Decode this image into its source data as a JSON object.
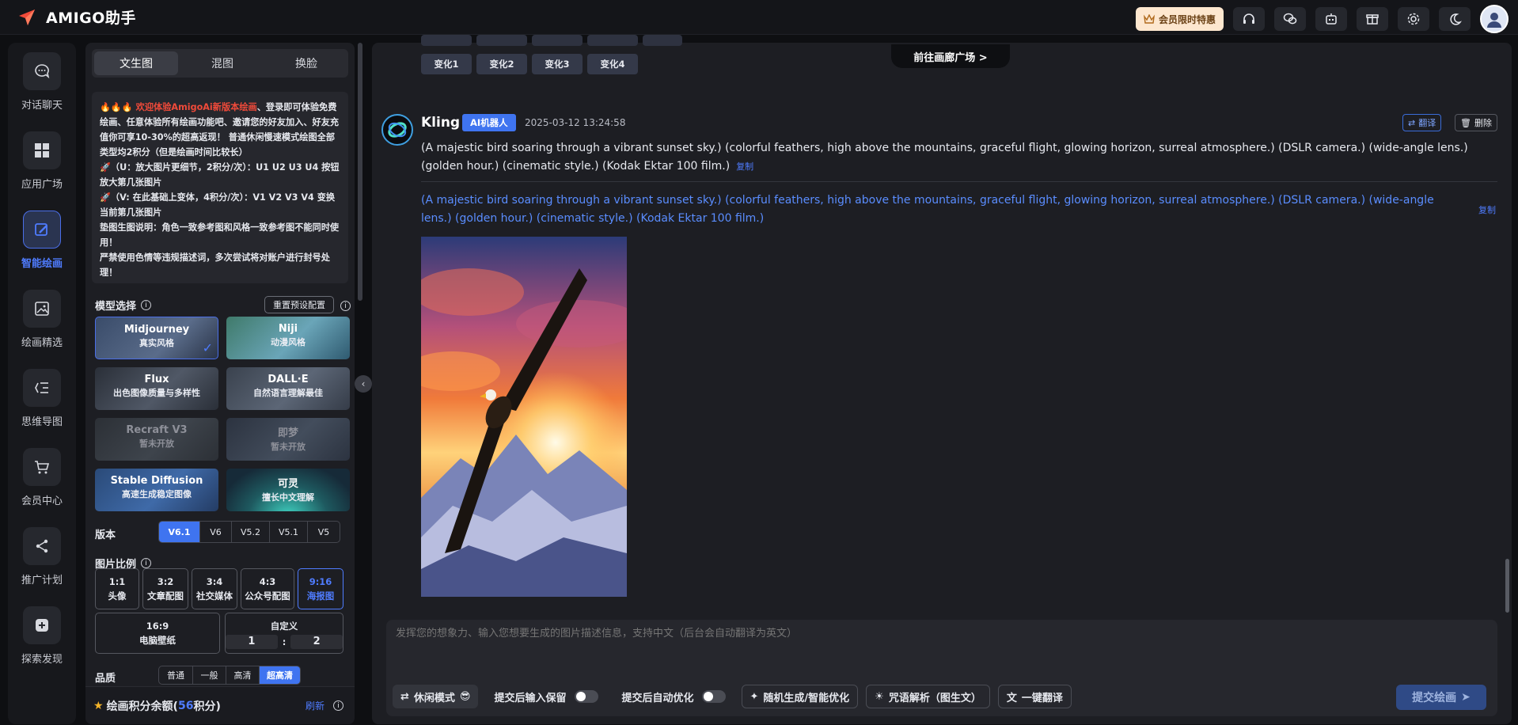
{
  "app": {
    "title": "AMIGO助手"
  },
  "header": {
    "vip_label": "会员限时特惠"
  },
  "nav": [
    {
      "id": "chat",
      "label": "对话聊天",
      "icon": "chat-icon"
    },
    {
      "id": "apps",
      "label": "应用广场",
      "icon": "grid-icon"
    },
    {
      "id": "draw",
      "label": "智能绘画",
      "icon": "brush-icon",
      "active": true
    },
    {
      "id": "gallery",
      "label": "绘画精选",
      "icon": "image-icon"
    },
    {
      "id": "mindmap",
      "label": "思维导图",
      "icon": "mindmap-icon"
    },
    {
      "id": "member",
      "label": "会员中心",
      "icon": "cart-icon"
    },
    {
      "id": "promote",
      "label": "推广计划",
      "icon": "share-icon"
    },
    {
      "id": "explore",
      "label": "探索发现",
      "icon": "explore-icon"
    }
  ],
  "panel": {
    "tabs": [
      {
        "label": "文生图",
        "active": true
      },
      {
        "label": "混图"
      },
      {
        "label": "换脸"
      }
    ],
    "notice": {
      "highlight": "🔥🔥🔥 欢迎体验AmigoAi新版本绘画",
      "body": "、登录即可体验免费绘画、任意体验所有绘画功能吧、邀请您的好友加入、好友充值你可享10-30%的超高返现！ 普通休闲慢速模式绘图全部类型均2积分（但是绘画时间比较长）",
      "line_u": "🚀（U：放大图片更细节，2积分/次）：U1 U2 U3 U4 按钮放大第几张图片",
      "line_v": "🚀（V: 在此基础上变体，4积分/次）：V1 V2 V3 V4 变换当前第几张图片",
      "line_ref": "垫图生图说明：角色一致参考图和风格一致参考图不能同时使用！",
      "line_warn": "严禁使用色情等违规描述词，多次尝试将对账户进行封号处理！"
    },
    "model_label": "模型选择",
    "reset_label": "重置预设配置",
    "models": [
      {
        "name": "Midjourney",
        "sub": "真实风格",
        "selected": true
      },
      {
        "name": "Niji",
        "sub": "动漫风格"
      },
      {
        "name": "Flux",
        "sub": "出色图像质量与多样性"
      },
      {
        "name": "DALL·E",
        "sub": "自然语言理解最佳"
      },
      {
        "name": "Recraft V3",
        "sub": "暂未开放",
        "disabled": true
      },
      {
        "name": "即梦",
        "sub": "暂未开放",
        "disabled": true
      },
      {
        "name": "Stable Diffusion",
        "sub": "高速生成稳定图像"
      },
      {
        "name": "可灵",
        "sub": "擅长中文理解"
      }
    ],
    "version_label": "版本",
    "versions": [
      "V6.1",
      "V6",
      "V5.2",
      "V5.1",
      "V5"
    ],
    "ratio_label": "图片比例",
    "ratios": [
      {
        "value": "1:1",
        "desc": "头像"
      },
      {
        "value": "3:2",
        "desc": "文章配图"
      },
      {
        "value": "3:4",
        "desc": "社交媒体"
      },
      {
        "value": "4:3",
        "desc": "公众号配图"
      },
      {
        "value": "9:16",
        "desc": "海报图",
        "active": true
      }
    ],
    "ratio_wide": {
      "value": "16:9",
      "desc": "电脑壁纸"
    },
    "custom": {
      "label": "自定义",
      "w": "1",
      "sep": ":",
      "h": "2"
    },
    "quality_label": "品质",
    "qualities": [
      "普通",
      "一般",
      "高清",
      "超高清"
    ],
    "points": {
      "prefix": "绘画积分余额(",
      "value": "56",
      "suffix": "积分)",
      "refresh": "刷新"
    }
  },
  "main": {
    "gallery_link": "前往画廊广场 >",
    "variations": [
      "变化1",
      "变化2",
      "变化3",
      "变化4"
    ],
    "message": {
      "name": "Kling",
      "badge": "AI机器人",
      "time": "2025-03-12 13:24:58",
      "translate": "翻译",
      "delete": "删除",
      "prompt": "(A majestic bird soaring through a vibrant sunset sky.) (colorful feathers, high above the mountains, graceful flight, glowing horizon, surreal atmosphere.) (DSLR camera.) (wide-angle lens.) (golden hour.) (cinematic style.) (Kodak Ektar 100 film.)",
      "copy": "复制",
      "prompt_en": " (A majestic bird soaring through a vibrant sunset sky.) (colorful feathers, high above the mountains, graceful flight, glowing horizon, surreal atmosphere.) (DSLR camera.) (wide-angle lens.) (golden hour.) (cinematic style.) (Kodak Ektar 100 film.)",
      "copy2": "复制"
    },
    "input": {
      "placeholder": "发挥您的想象力、输入您想要生成的图片描述信息，支持中文（后台会自动翻译为英文）",
      "mode": "休闲模式",
      "keep_after": "提交后输入保留",
      "auto_opt": "提交后自动优化",
      "random": "随机生成/智能优化",
      "parse": "咒语解析（图生文）",
      "translate": "一键翻译",
      "submit": "提交绘画"
    }
  }
}
